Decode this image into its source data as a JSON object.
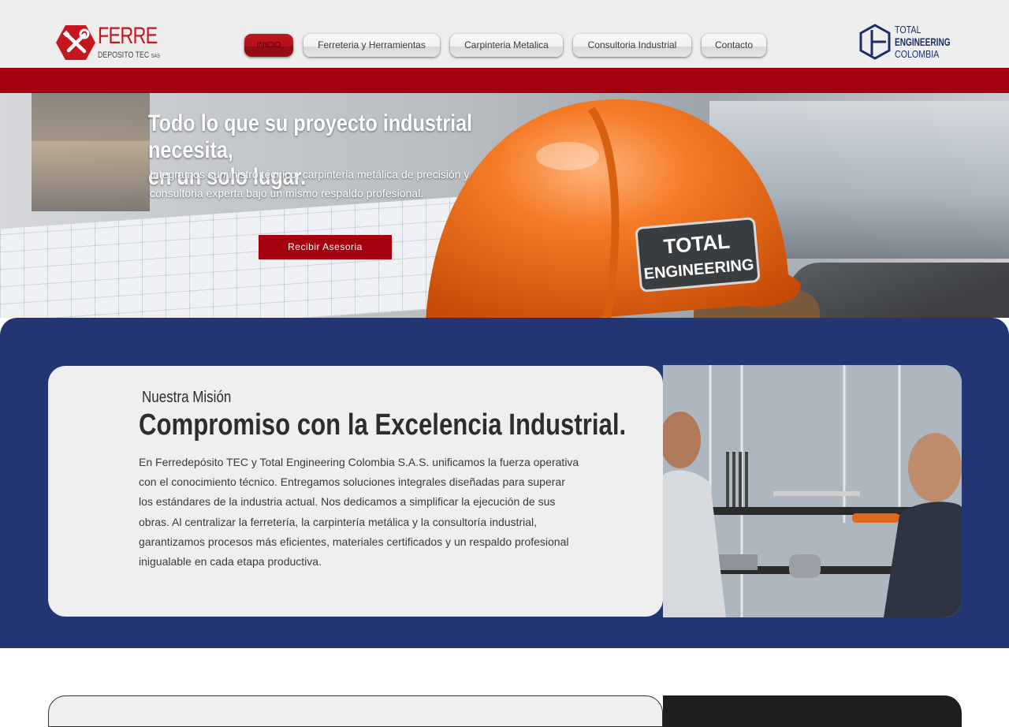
{
  "header": {
    "logo_left": {
      "brand": "FERRE",
      "sub": "DEPOSITO TEC",
      "sub_small": "SAS"
    },
    "nav": [
      {
        "label": "INICIO",
        "active": true
      },
      {
        "label": "Ferreteria y Herramientas",
        "active": false
      },
      {
        "label": "Carpinteria Metalica",
        "active": false
      },
      {
        "label": "Consultoria Industrial",
        "active": false
      },
      {
        "label": "Contacto",
        "active": false
      }
    ],
    "logo_right": {
      "line1": "TOTAL",
      "line2": "ENGINEERING",
      "line3": "COLOMBIA"
    }
  },
  "hero": {
    "title_line1": "Todo lo que su proyecto industrial necesita,",
    "title_line2": "en un solo lugar.",
    "subtitle": "Integramos suministro técnico, carpinteria metálica de precisión y consultoria experta bajo un mismo respaldo profesional.",
    "cta": "Recibir Asesoria",
    "helmet_badge_line1": "TOTAL",
    "helmet_badge_line2": "ENGINEERING"
  },
  "mission": {
    "kicker": "Nuestra Misión",
    "heading": "Compromiso con la Excelencia Industrial.",
    "body": "En Ferredepósito TEC y Total Engineering Colombia S.A.S. unificamos la fuerza operativa con el conocimiento técnico. Entregamos soluciones integrales diseñadas para superar los estándares de la industria actual. Nos dedicamos a simplificar la ejecución de sus obras. Al centralizar la ferretería, la carpintería metálica y la consultoría industrial, garantizamos procesos más eficientes, materiales certificados y un respaldo profesional inigualable en cada etapa productiva."
  },
  "colors": {
    "brand_red": "#a5000f",
    "navy": "#243574",
    "card_bg": "#efeff0",
    "helmet_orange": "#f26b12"
  }
}
